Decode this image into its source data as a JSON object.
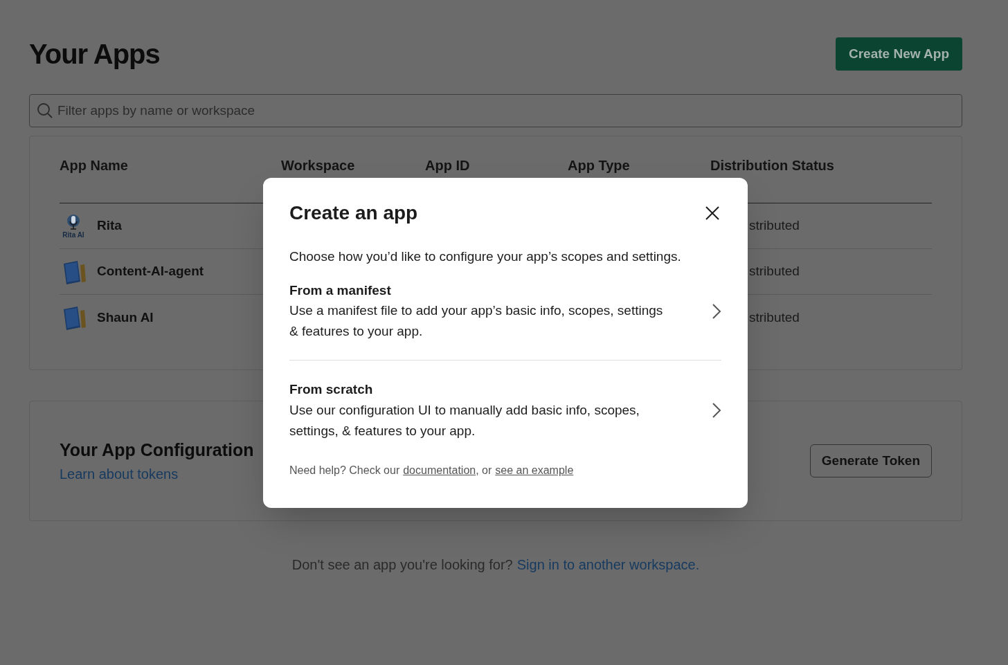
{
  "page": {
    "title": "Your Apps",
    "create_button": "Create New App",
    "search": {
      "placeholder": "Filter apps by name or workspace"
    }
  },
  "table": {
    "columns": [
      "App Name",
      "Workspace",
      "App ID",
      "App Type",
      "Distribution Status"
    ],
    "rows": [
      {
        "name": "Rita",
        "kind": "logo",
        "icon_caption": "Rita AI",
        "distribution_status": "stributed"
      },
      {
        "name": "Content-AI-agent",
        "kind": "book",
        "distribution_status": "stributed"
      },
      {
        "name": "Shaun AI",
        "kind": "book",
        "distribution_status": "stributed"
      }
    ]
  },
  "token_card": {
    "title": "Your App Configuration",
    "link": "Learn about tokens",
    "button": "Generate Token"
  },
  "footer": {
    "text": "Don't see an app you're looking for?",
    "link": "Sign in to another workspace."
  },
  "modal": {
    "title": "Create an app",
    "description": "Choose how you’d like to configure your app’s scopes and settings.",
    "options": [
      {
        "title": "From a manifest",
        "description": "Use a manifest file to add your app’s basic info, scopes, settings & features to your app."
      },
      {
        "title": "From scratch",
        "description": "Use our configuration UI to manually add basic info, scopes, settings, & features to your app."
      }
    ],
    "help": {
      "text": "Need help? Check our",
      "link_1": "documentation",
      "between": ", or",
      "link_2": "see an example"
    }
  }
}
